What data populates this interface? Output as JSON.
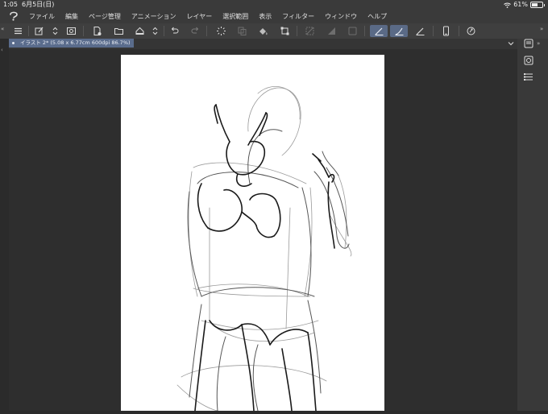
{
  "status": {
    "time": "1:05",
    "date": "6月5日(日)",
    "battery": "61%",
    "battery_level": 0.61
  },
  "menu": {
    "items": [
      "ファイル",
      "編集",
      "ページ管理",
      "アニメーション",
      "レイヤー",
      "選択範囲",
      "表示",
      "フィルター",
      "ウィンドウ",
      "ヘルプ"
    ]
  },
  "tab": {
    "label": "イラスト 2* (5.08 x 6.77cm 600dpi 86.7%)"
  },
  "toolbar": {
    "icons": [
      "menu-icon",
      "new-canvas-icon",
      "up-down-arrows-icon",
      "view-icon",
      "new-file-icon",
      "open-folder-icon",
      "save-icon",
      "up-down-arrows-icon",
      "undo-icon",
      "redo-icon",
      "loading-icon",
      "copy-icon",
      "fill-icon",
      "transform-icon",
      "deselect-icon",
      "clear-icon",
      "clear-outside-icon",
      "pen-stabilizer-icon",
      "pen-stabilizer-curve-icon",
      "ruler-pen-icon",
      "smartphone-icon",
      "gesture-icon"
    ]
  }
}
